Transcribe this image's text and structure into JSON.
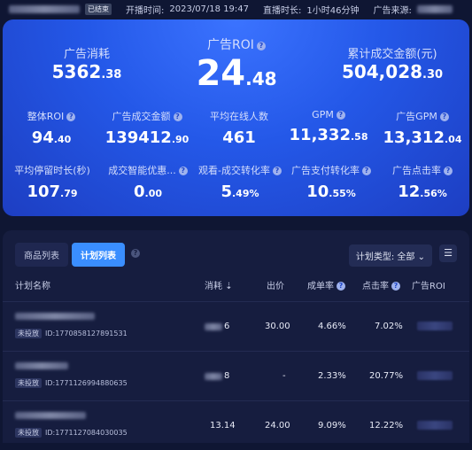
{
  "topbar": {
    "status_badge": "已结束",
    "start_time_label": "开播时间:",
    "start_time": "2023/07/18 19:47",
    "duration_label": "直播时长:",
    "duration": "1小时46分钟",
    "source_label": "广告来源:"
  },
  "stats": {
    "ad_spend": {
      "label": "广告消耗",
      "int": "5362",
      "dec": ".38"
    },
    "ad_roi": {
      "label": "广告ROI",
      "int": "24",
      "dec": ".48"
    },
    "total_gmv": {
      "label": "累计成交金额(元)",
      "int": "504,028",
      "dec": ".30"
    },
    "overall_roi": {
      "label": "整体ROI",
      "int": "94",
      "dec": ".40"
    },
    "ad_gmv": {
      "label": "广告成交金额",
      "int": "139412",
      "dec": ".90"
    },
    "avg_online": {
      "label": "平均在线人数",
      "int": "461",
      "dec": ""
    },
    "gpm": {
      "label": "GPM",
      "int": "11,332",
      "dec": ".58"
    },
    "ad_gpm": {
      "label": "广告GPM",
      "int": "13,312",
      "dec": ".04"
    },
    "avg_stay": {
      "label": "平均停留时长(秒)",
      "int": "107",
      "dec": ".79"
    },
    "smart_coupon": {
      "label": "成交智能优惠...",
      "int": "0",
      "dec": ".00"
    },
    "watch_conv": {
      "label": "观看-成交转化率",
      "int": "5",
      "dec": ".49%"
    },
    "ad_pay_conv": {
      "label": "广告支付转化率",
      "int": "10",
      "dec": ".55%"
    },
    "ad_ctr": {
      "label": "广告点击率",
      "int": "12",
      "dec": ".56%"
    }
  },
  "panel": {
    "tab_products": "商品列表",
    "tab_plans": "计划列表",
    "plan_type": "计划类型: 全部",
    "columns": {
      "name": "计划名称",
      "spend": "消耗",
      "bid": "出价",
      "conv": "成单率",
      "ctr": "点击率",
      "roi": "广告ROI"
    },
    "rows": [
      {
        "status": "未投放",
        "id": "ID:1770858127891531",
        "spend": "6",
        "bid": "30.00",
        "conv": "4.66%",
        "ctr": "7.02%"
      },
      {
        "status": "未投放",
        "id": "ID:1771126994880635",
        "spend": "8",
        "bid": "-",
        "conv": "2.33%",
        "ctr": "20.77%"
      },
      {
        "status": "未投放",
        "id": "ID:1771127084030035",
        "spend": "13.14",
        "bid": "24.00",
        "conv": "9.09%",
        "ctr": "12.22%"
      }
    ]
  }
}
